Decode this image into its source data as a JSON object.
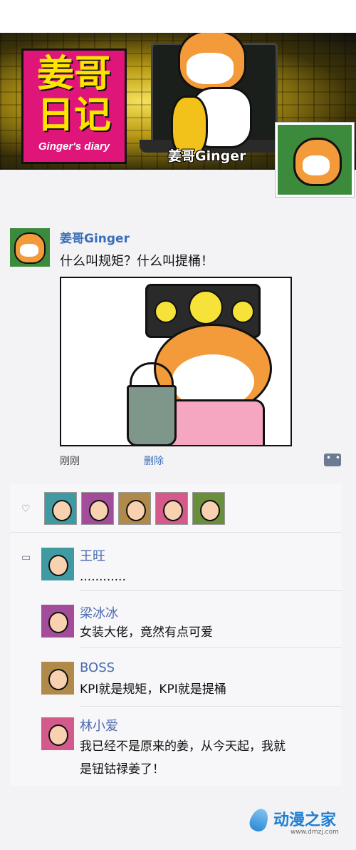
{
  "header": {
    "logo_line1": "姜哥",
    "logo_line2": "日记",
    "logo_sub": "Ginger's diary",
    "name": "姜哥Ginger"
  },
  "post": {
    "author": "姜哥Ginger",
    "text": "什么叫规矩？什么叫提桶！",
    "time": "刚刚",
    "delete_label": "删除"
  },
  "likes": {
    "avatars": [
      "avatar-1",
      "avatar-2",
      "avatar-3",
      "avatar-4",
      "avatar-5"
    ]
  },
  "comments": [
    {
      "name": "王旺",
      "text": "............"
    },
    {
      "name": "梁冰冰",
      "text": "女装大佬，竟然有点可爱"
    },
    {
      "name": "BOSS",
      "text": "KPI就是规矩，KPI就是提桶"
    },
    {
      "name": "林小爱",
      "text_line1": "我已经不是原来的姜，从今天起，我就",
      "text_line2": "是钮钴禄姜了！"
    }
  ],
  "watermark": {
    "title": "动漫之家",
    "url": "www.dmzj.com"
  },
  "colors": {
    "link_blue": "#3a6fb8",
    "logo_pink": "#e0157a",
    "logo_yellow": "#ffe400"
  }
}
